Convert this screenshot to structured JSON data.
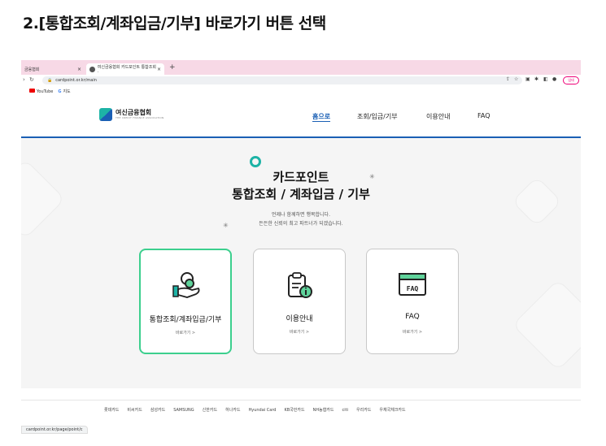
{
  "heading": "2.[통합조회/계좌입금/기부] 바로가기 버튼 선택",
  "browser": {
    "tabs": [
      {
        "label": "금융협회"
      },
      {
        "label": "여신금융협회 카드포인트 통합조회 ·"
      }
    ],
    "new_tab": "+",
    "url": "cardpoint.or.kr/main",
    "update_button": "업데",
    "bookmarks": [
      {
        "label": "YouTube"
      },
      {
        "label": "지도"
      }
    ]
  },
  "site": {
    "logo_text": "여신금융협회",
    "logo_sub": "THE CREDIT FINANCE ASSOCIATION",
    "nav": [
      {
        "label": "홈으로"
      },
      {
        "label": "조회/입금/기부"
      },
      {
        "label": "이용안내"
      },
      {
        "label": "FAQ"
      }
    ]
  },
  "hero": {
    "title_line1": "카드포인트",
    "title_line2": "통합조회 / 계좌입금 / 기부",
    "subtitle_line1": "언제나 함께하면 행복합니다.",
    "subtitle_line2": "든든한 신뢰의 최고 파트너가 되겠습니다."
  },
  "cards": [
    {
      "title": "통합조회/계좌입금/기부",
      "link": "바로가기 >",
      "icon": "hand-coins-icon",
      "highlighted": true
    },
    {
      "title": "이용안내",
      "link": "바로가기 >",
      "icon": "clipboard-info-icon",
      "highlighted": false
    },
    {
      "title": "FAQ",
      "link": "바로가기 >",
      "icon": "faq-window-icon",
      "highlighted": false
    }
  ],
  "partners": [
    "롯데카드",
    "비씨카드",
    "삼성카드",
    "SAMSUNG",
    "신한카드",
    "하나카드",
    "Hyundai Card",
    "KB국민카드",
    "NH농협카드",
    "citi",
    "우리카드",
    "우체국체크카드"
  ],
  "status_url": "cardpoint.or.kr/page/point/c"
}
